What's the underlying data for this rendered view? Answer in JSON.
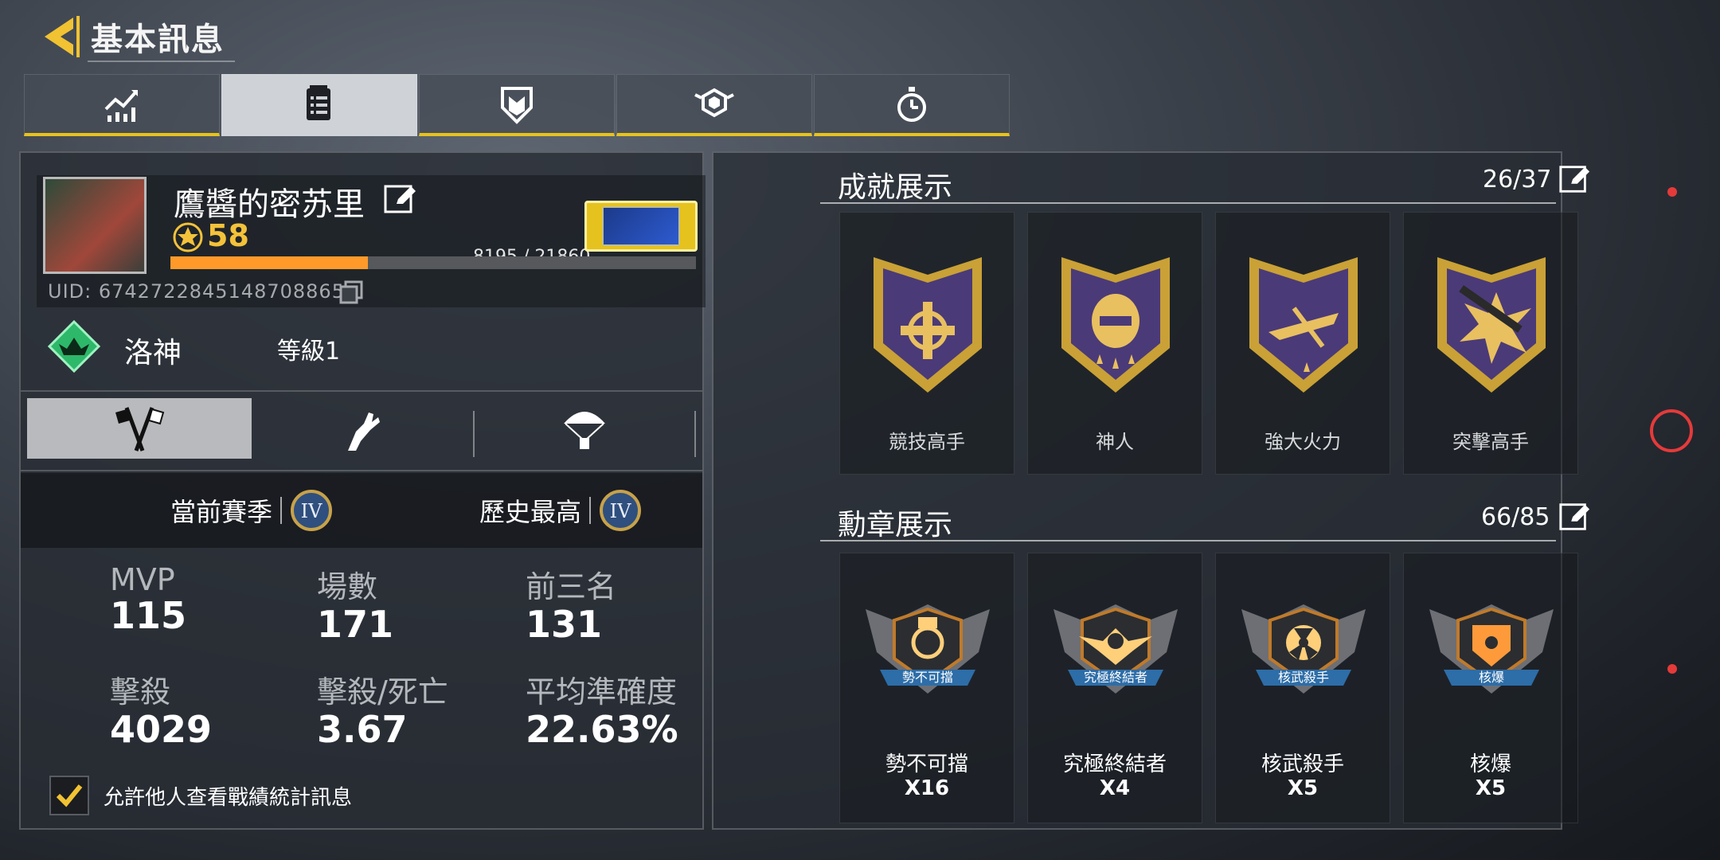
{
  "header": {
    "title": "基本訊息"
  },
  "tabs": [
    {
      "icon": "stats-chart-icon",
      "active": false
    },
    {
      "icon": "document-list-icon",
      "active": true
    },
    {
      "icon": "shield-icon",
      "active": false
    },
    {
      "icon": "hexagon-wings-icon",
      "active": false
    },
    {
      "icon": "stopwatch-icon",
      "active": false
    }
  ],
  "profile": {
    "nickname": "鷹醬的密苏里",
    "level": "58",
    "xp_text": "8195 / 21860",
    "xp_progress": 0.375,
    "uid": "UID: 6742722845148708865"
  },
  "rank": {
    "name": "洛神",
    "level": "等級1"
  },
  "season": {
    "current_label": "當前賽季",
    "best_label": "歷史最高",
    "current_tier": "IV",
    "best_tier": "IV"
  },
  "stats": {
    "mvp": {
      "label": "MVP",
      "value": "115"
    },
    "matches": {
      "label": "場數",
      "value": "171"
    },
    "top3": {
      "label": "前三名",
      "value": "131"
    },
    "kills": {
      "label": "擊殺",
      "value": "4029"
    },
    "kd": {
      "label": "擊殺/死亡",
      "value": "3.67"
    },
    "accuracy": {
      "label": "平均準確度",
      "value": "22.63%"
    }
  },
  "allow_text": "允許他人查看戰績統計訊息",
  "achievements": {
    "title": "成就展示",
    "count": "26/37",
    "items": [
      {
        "label": "競技高手"
      },
      {
        "label": "神人"
      },
      {
        "label": "強大火力"
      },
      {
        "label": "突擊高手"
      }
    ]
  },
  "medals": {
    "title": "勳章展示",
    "count": "66/85",
    "items": [
      {
        "banner": "勢不可擋",
        "label": "勢不可擋",
        "count": "X16"
      },
      {
        "banner": "究極終結者",
        "label": "究極終結者",
        "count": "X4"
      },
      {
        "banner": "核武殺手",
        "label": "核武殺手",
        "count": "X5"
      },
      {
        "banner": "核爆",
        "label": "核爆",
        "count": "X5"
      }
    ]
  },
  "colors": {
    "accent": "#e6c21e",
    "xp": "#ff9a2a",
    "record": "#e53a3a"
  }
}
